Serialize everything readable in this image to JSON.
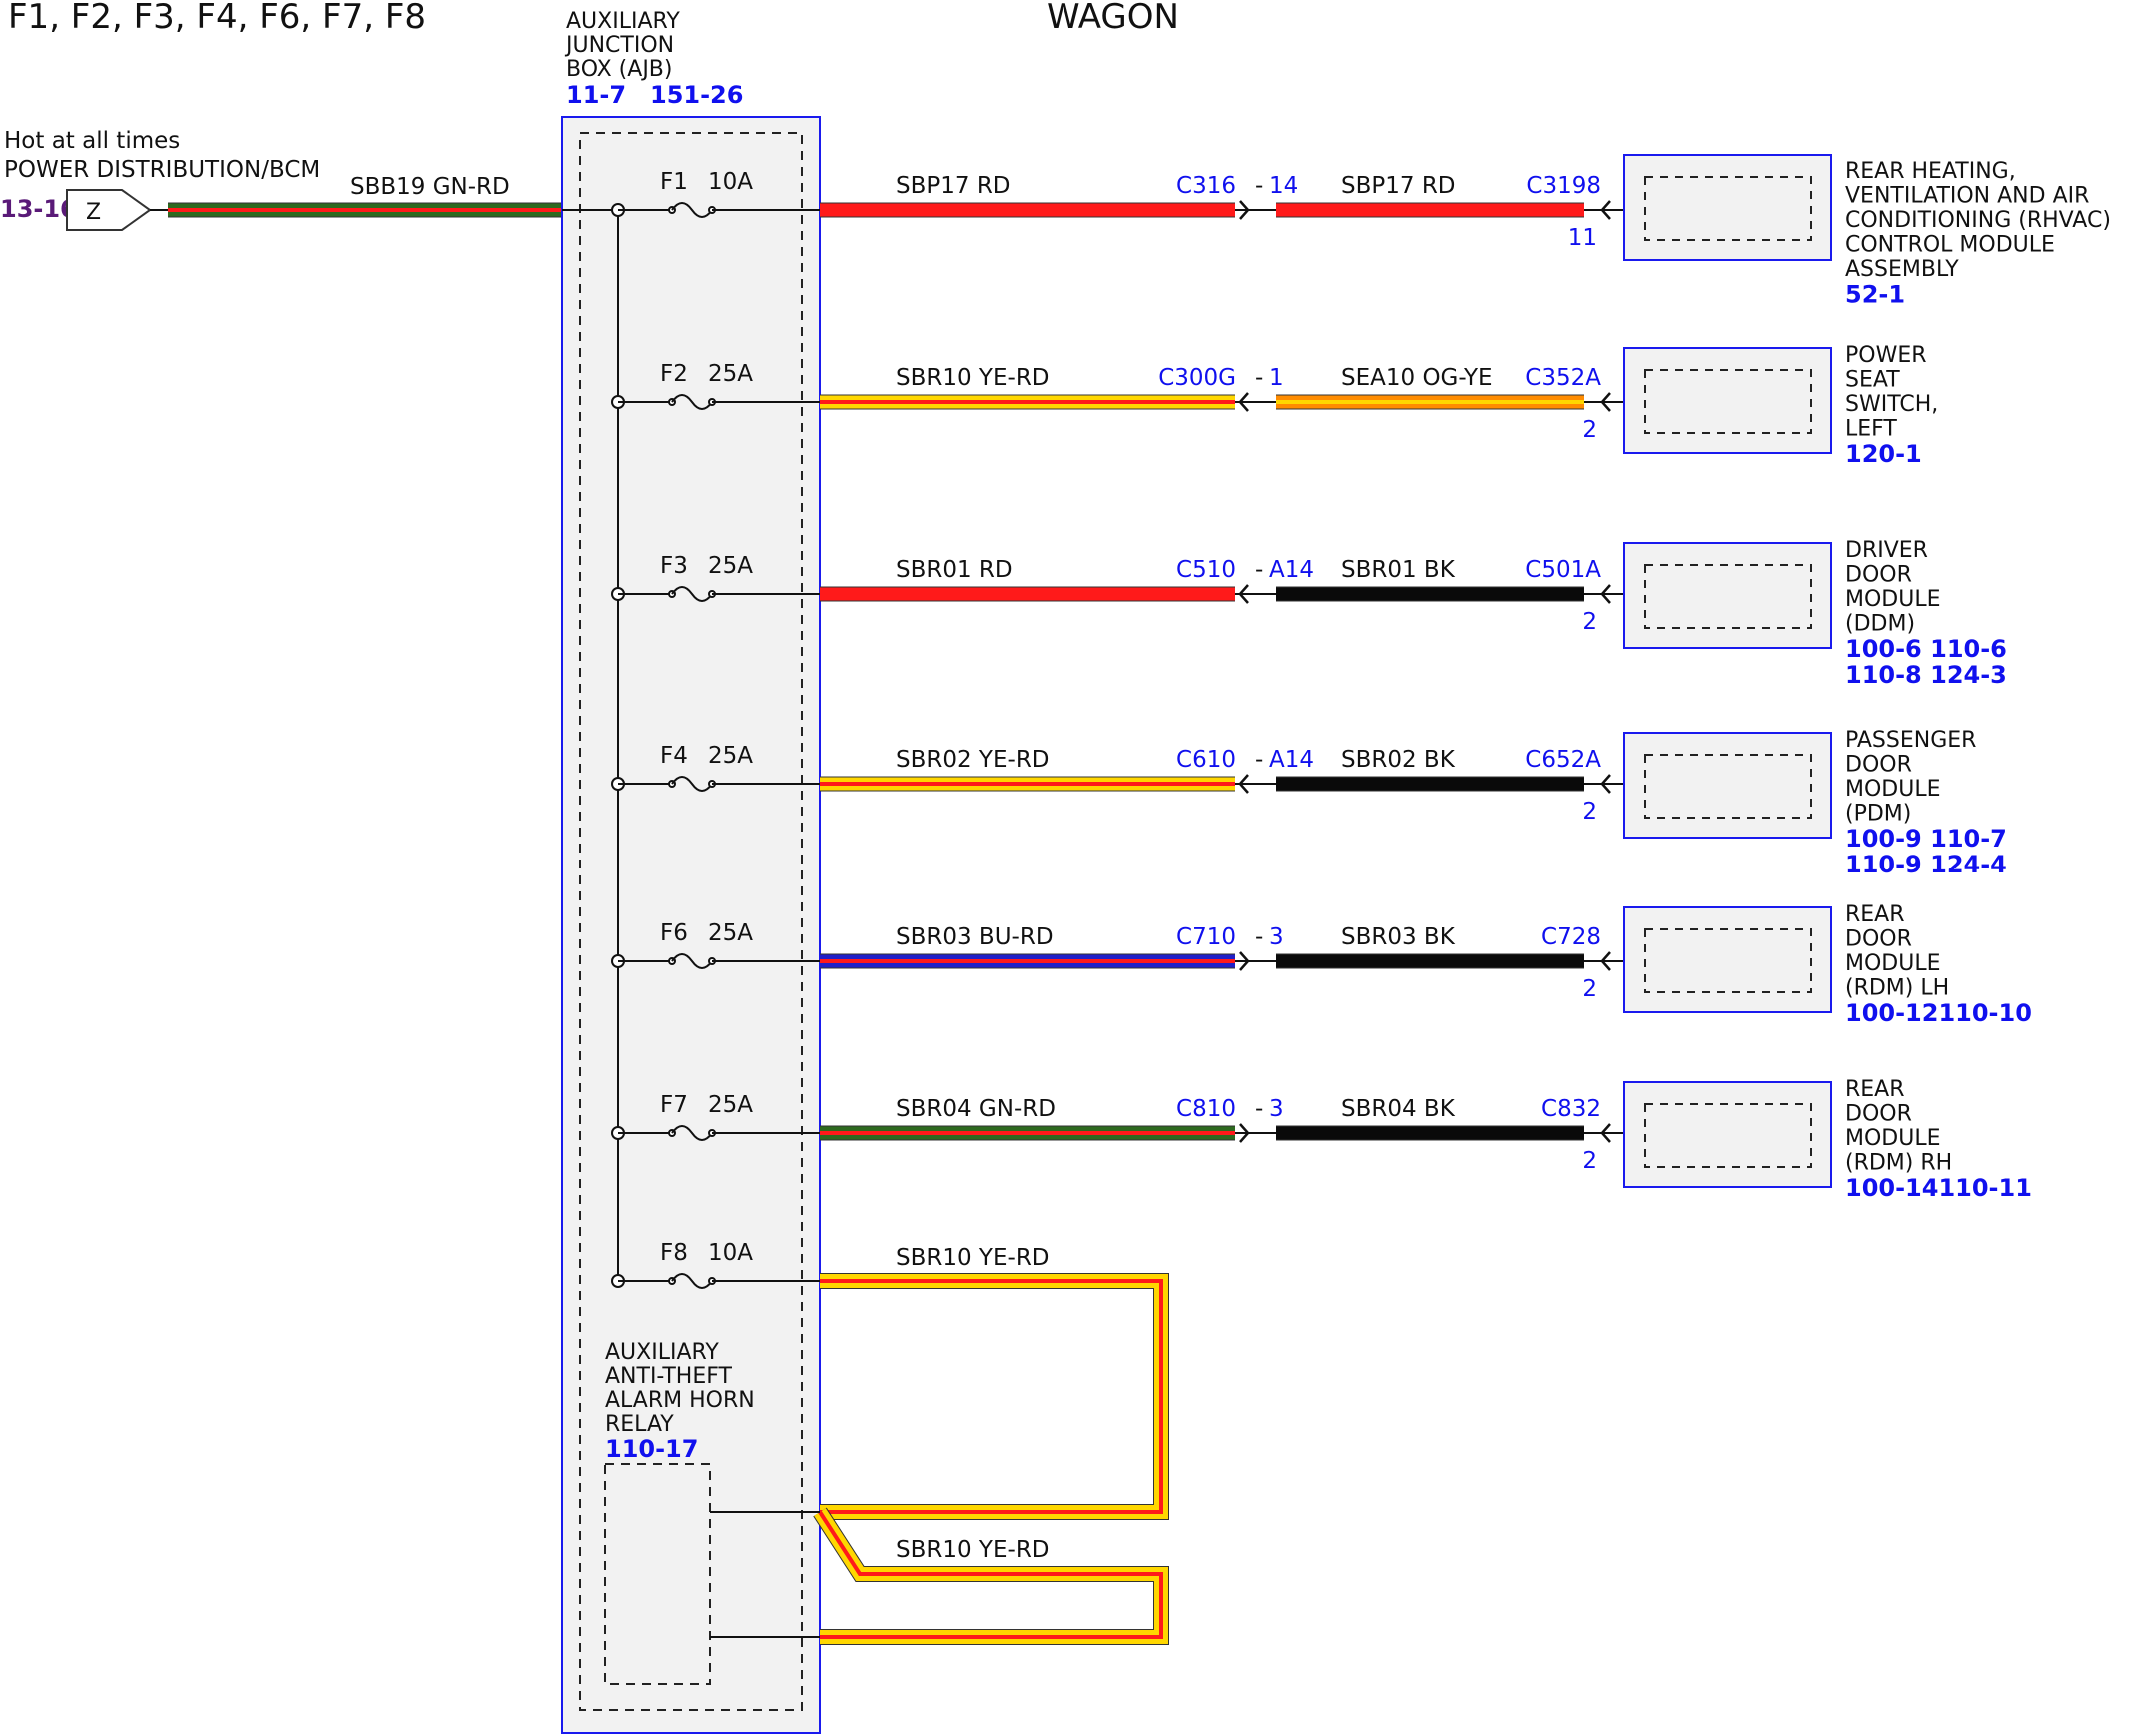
{
  "header": {
    "fuses_title": "F1, F2, F3, F4, F6, F7, F8",
    "variant_title": "WAGON"
  },
  "colors": {
    "GN": "#2d6a1f",
    "RD": "#ff1a1a",
    "YE": "#ffd700",
    "BU": "#2020c8",
    "BK": "#0a0a0a",
    "OG": "#ff8c00",
    "blue_text": "#1010ee",
    "purple_text": "#5a1a78",
    "box_fill": "#f2f2f2",
    "box_border": "#1a1aee"
  },
  "source": {
    "line1": "Hot at all times",
    "line2": "POWER DISTRIBUTION/BCM",
    "ref": "13-16",
    "connector_label": "Z",
    "wire": "SBB19  GN-RD"
  },
  "ajb": {
    "line1": "AUXILIARY",
    "line2": "JUNCTION",
    "line3": "BOX (AJB)",
    "ref1": "11-7",
    "ref2": "151-26"
  },
  "fuses": [
    {
      "id": "F1",
      "rating": "10A"
    },
    {
      "id": "F2",
      "rating": "25A"
    },
    {
      "id": "F3",
      "rating": "25A"
    },
    {
      "id": "F4",
      "rating": "25A"
    },
    {
      "id": "F6",
      "rating": "25A"
    },
    {
      "id": "F7",
      "rating": "25A"
    },
    {
      "id": "F8",
      "rating": "10A"
    }
  ],
  "circuits": [
    {
      "wire1": "SBP17  RD",
      "colors1": [
        "RD"
      ],
      "conn": "C316",
      "pin": "14",
      "wire2": "SBP17  RD",
      "colors2": [
        "RD"
      ],
      "end_conn": "C3198",
      "end_pin": "11",
      "module_lines": [
        "REAR HEATING,",
        "VENTILATION AND AIR",
        "CONDITIONING (RHVAC)",
        "CONTROL MODULE",
        "ASSEMBLY"
      ],
      "refs": [
        "52-1"
      ]
    },
    {
      "wire1": "SBR10  YE-RD",
      "colors1": [
        "YE",
        "RD"
      ],
      "conn": "C300G",
      "pin": "1",
      "wire2": "SEA10  OG-YE",
      "colors2": [
        "OG",
        "YE"
      ],
      "end_conn": "C352A",
      "end_pin": "2",
      "module_lines": [
        "POWER",
        "SEAT",
        "SWITCH,",
        "LEFT"
      ],
      "refs": [
        "120-1"
      ]
    },
    {
      "wire1": "SBR01  RD",
      "colors1": [
        "RD"
      ],
      "conn": "C510",
      "pin": "A14",
      "wire2": "SBR01  BK",
      "colors2": [
        "BK"
      ],
      "end_conn": "C501A",
      "end_pin": "2",
      "module_lines": [
        "DRIVER",
        "DOOR",
        "MODULE",
        "(DDM)"
      ],
      "refs": [
        "100-6  110-6",
        "110-8 124-3"
      ]
    },
    {
      "wire1": "SBR02  YE-RD",
      "colors1": [
        "YE",
        "RD"
      ],
      "conn": "C610",
      "pin": "A14",
      "wire2": "SBR02  BK",
      "colors2": [
        "BK"
      ],
      "end_conn": "C652A",
      "end_pin": "2",
      "module_lines": [
        "PASSENGER",
        "DOOR",
        "MODULE",
        "(PDM)"
      ],
      "refs": [
        "100-9  110-7",
        "110-9 124-4"
      ]
    },
    {
      "wire1": "SBR03  BU-RD",
      "colors1": [
        "BU",
        "RD"
      ],
      "conn": "C710",
      "pin": "3",
      "wire2": "SBR03  BK",
      "colors2": [
        "BK"
      ],
      "end_conn": "C728",
      "end_pin": "2",
      "module_lines": [
        "REAR",
        "DOOR",
        "MODULE",
        "(RDM) LH"
      ],
      "refs": [
        "100-12110-10"
      ]
    },
    {
      "wire1": "SBR04  GN-RD",
      "colors1": [
        "GN",
        "RD"
      ],
      "conn": "C810",
      "pin": "3",
      "wire2": "SBR04  BK",
      "colors2": [
        "BK"
      ],
      "end_conn": "C832",
      "end_pin": "2",
      "module_lines": [
        "REAR",
        "DOOR",
        "MODULE",
        "(RDM) RH"
      ],
      "refs": [
        "100-14110-11"
      ]
    }
  ],
  "f8_circuit": {
    "wire_top": "SBR10  YE-RD",
    "wire_bottom": "SBR10  YE-RD",
    "colors": [
      "YE",
      "RD"
    ]
  },
  "relay": {
    "lines": [
      "AUXILIARY",
      "ANTI-THEFT",
      "ALARM HORN",
      "RELAY"
    ],
    "ref": "110-17"
  }
}
